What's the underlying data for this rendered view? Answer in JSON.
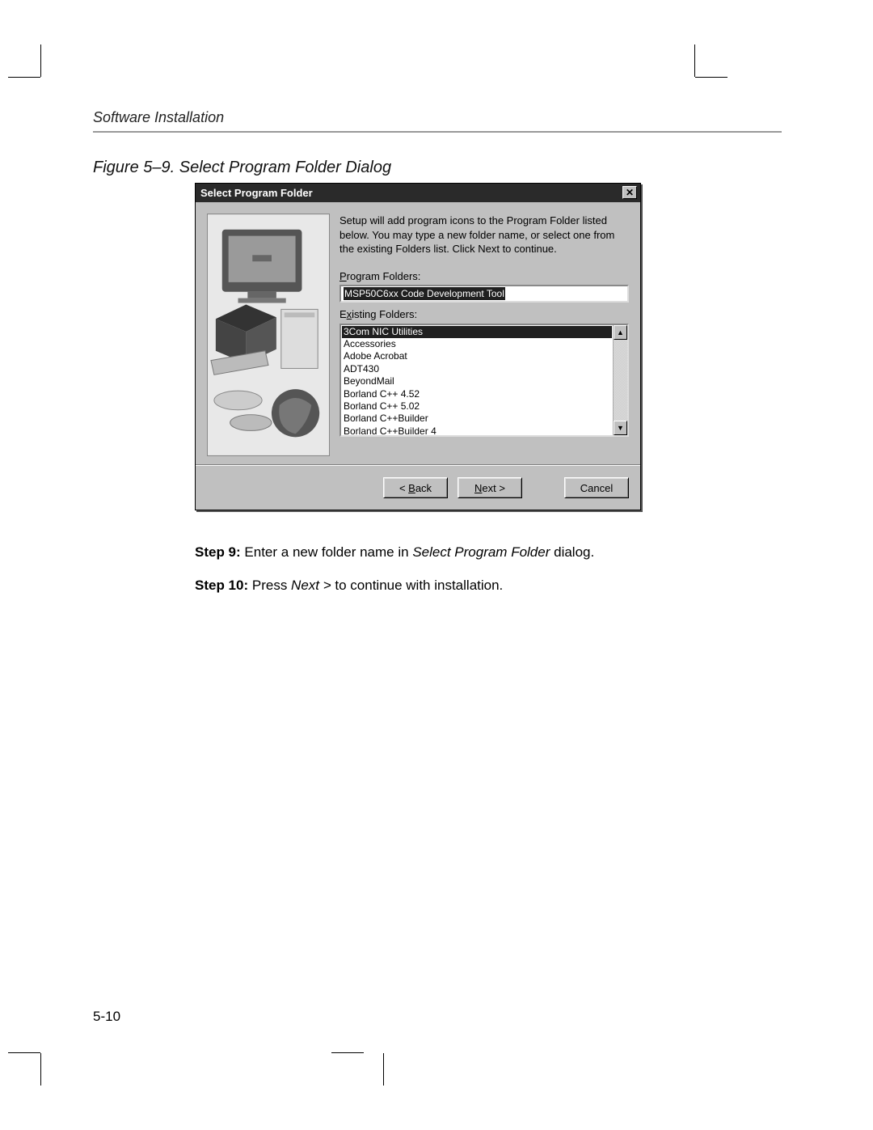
{
  "header": {
    "section": "Software Installation"
  },
  "figure": {
    "caption": "Figure 5–9. Select Program Folder Dialog"
  },
  "dialog": {
    "title": "Select Program Folder",
    "close_aria": "Close",
    "instruction": "Setup will add program icons to the Program Folder listed below. You may type a new folder name, or select one from the existing Folders list.  Click Next to continue.",
    "program_folders_label": "Program Folders:",
    "program_folders_value": "MSP50C6xx Code Development Tool",
    "existing_label_prefix": "E",
    "existing_label_ul": "x",
    "existing_label_suffix": "isting Folders:",
    "existing_items": [
      "3Com NIC Utilities",
      "Accessories",
      "Adobe Acrobat",
      "ADT430",
      "BeyondMail",
      "Borland C++ 4.52",
      "Borland C++ 5.02",
      "Borland C++Builder",
      "Borland C++Builder 4"
    ],
    "buttons": {
      "back_pre": "< ",
      "back_ul": "B",
      "back_post": "ack",
      "next_ul": "N",
      "next_post": "ext >",
      "cancel": "Cancel"
    }
  },
  "steps": {
    "s9_label": "Step 9:",
    "s9_pre": " Enter a new folder name in ",
    "s9_ital": "Select Program Folder",
    "s9_post": " dialog.",
    "s10_label": "Step 10:",
    "s10_pre": " Press ",
    "s10_ital": "Next >",
    "s10_post": " to continue with installation."
  },
  "page_number": "5-10"
}
